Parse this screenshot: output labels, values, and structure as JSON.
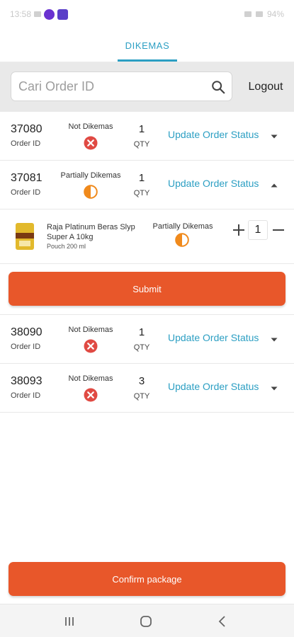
{
  "status_bar": {
    "time": "13:58",
    "battery": "94%"
  },
  "tab": {
    "label": "DIKEMAS"
  },
  "search": {
    "placeholder": "Cari Order ID",
    "value": ""
  },
  "header": {
    "logout_label": "Logout"
  },
  "orders": [
    {
      "order_id": "37080",
      "order_id_label": "Order ID",
      "status": "Not Dikemas",
      "status_icon": "x-circle-icon",
      "qty": "1",
      "qty_label": "QTY",
      "action": "Update Order Status",
      "expanded": false
    },
    {
      "order_id": "37081",
      "order_id_label": "Order ID",
      "status": "Partially Dikemas",
      "status_icon": "half-circle-icon",
      "qty": "1",
      "qty_label": "QTY",
      "action": "Update Order Status",
      "expanded": true
    },
    {
      "order_id": "38090",
      "order_id_label": "Order ID",
      "status": "Not Dikemas",
      "status_icon": "x-circle-icon",
      "qty": "1",
      "qty_label": "QTY",
      "action": "Update Order Status",
      "expanded": false
    },
    {
      "order_id": "38093",
      "order_id_label": "Order ID",
      "status": "Not Dikemas",
      "status_icon": "x-circle-icon",
      "qty": "3",
      "qty_label": "QTY",
      "action": "Update Order Status",
      "expanded": false
    }
  ],
  "expanded_item": {
    "name": "Raja Platinum Beras Slyp Super A 10kg",
    "variant": "Pouch 200 ml",
    "status": "Partially Dikemas",
    "status_icon": "half-circle-icon",
    "quantity": "1",
    "submit_label": "Submit"
  },
  "footer": {
    "confirm_label": "Confirm package"
  },
  "colors": {
    "accent": "#2c9fc3",
    "primary_button": "#e8572a",
    "not_packed": "#e04a43",
    "partial": "#f08a1c"
  }
}
